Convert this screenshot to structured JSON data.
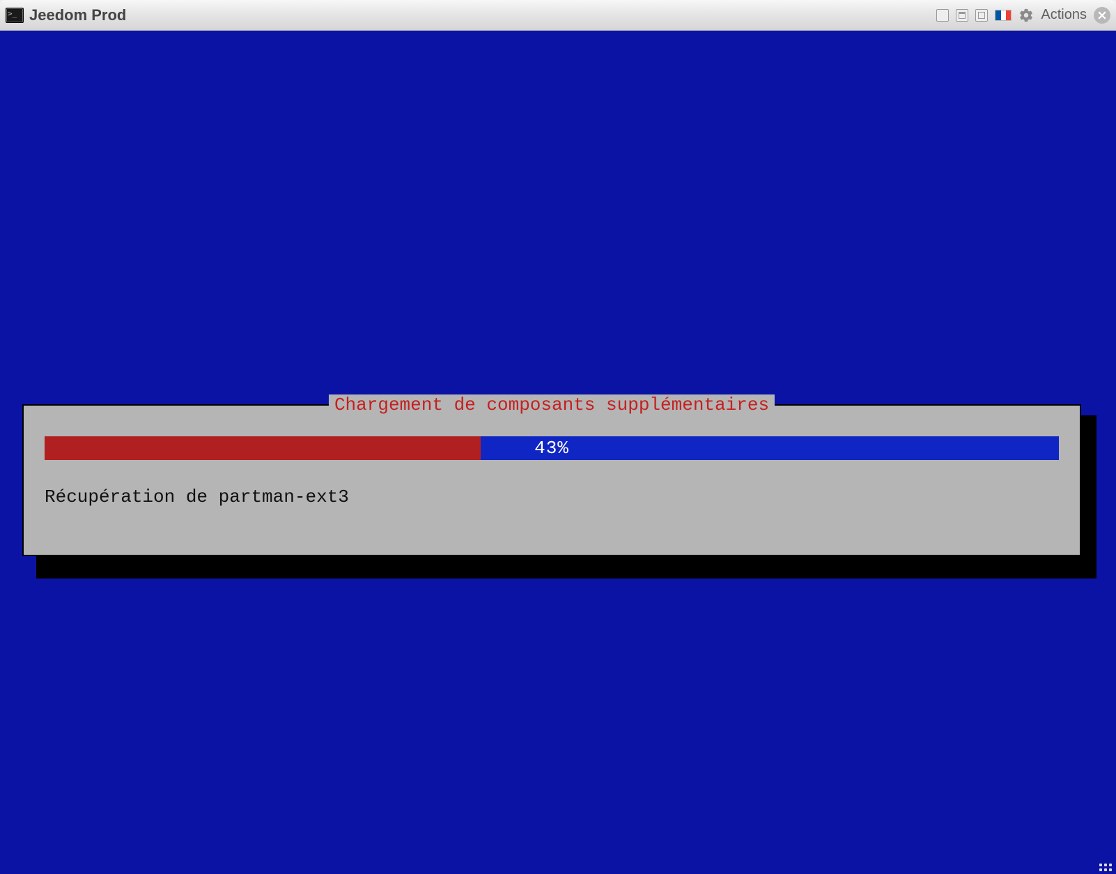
{
  "window": {
    "title": "Jeedom Prod",
    "actions_label": "Actions",
    "flag_colors": [
      "#0055A4",
      "#FFFFFF",
      "#EF4135"
    ]
  },
  "installer": {
    "dialog_title": "Chargement de composants supplémentaires",
    "progress_percent": 43,
    "progress_label": "43%",
    "status_text": "Récupération de partman-ext3"
  }
}
